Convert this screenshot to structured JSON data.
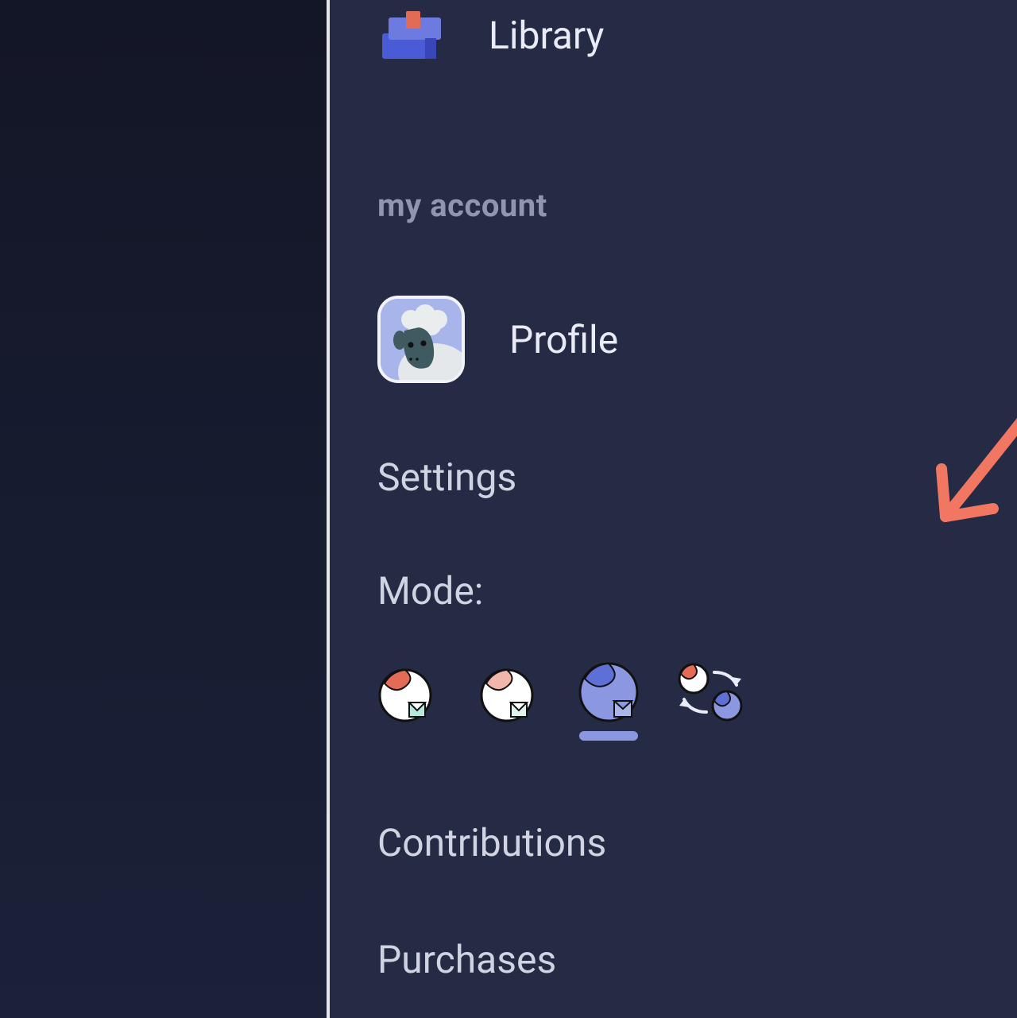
{
  "nav": {
    "library_label": "Library"
  },
  "account": {
    "section_header": "my account",
    "profile_label": "Profile",
    "settings_label": "Settings",
    "mode_label": "Mode:",
    "contributions_label": "Contributions",
    "purchases_label": "Purchases"
  },
  "modes": {
    "options": [
      "light",
      "light-soft",
      "dark",
      "auto"
    ],
    "active_index": 2
  },
  "annotation": {
    "arrow_color": "#f27762"
  }
}
